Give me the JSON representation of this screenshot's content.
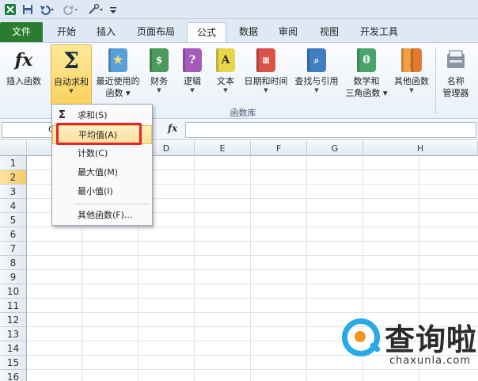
{
  "tabs": [
    {
      "label": "文件",
      "kind": "file"
    },
    {
      "label": "开始"
    },
    {
      "label": "插入"
    },
    {
      "label": "页面布局"
    },
    {
      "label": "公式",
      "active": true
    },
    {
      "label": "数据"
    },
    {
      "label": "审阅"
    },
    {
      "label": "视图"
    },
    {
      "label": "开发工具"
    }
  ],
  "ribbon": {
    "insert_function": "插入函数",
    "autosum": "自动求和",
    "recent_line1": "最近使用的",
    "recent_line2": "函数",
    "finance": "财务",
    "logic": "逻辑",
    "text": "文本",
    "datetime": "日期和时间",
    "lookup": "查找与引用",
    "math_line1": "数学和",
    "math_line2": "三角函数",
    "other": "其他函数",
    "name_mgr_line1": "名称",
    "name_mgr_line2": "管理器",
    "group_label": "函数库",
    "icon_fx": "fx",
    "icon_sigma": "Σ",
    "icon_q": "?",
    "icon_a": "A",
    "icon_theta": "θ"
  },
  "formula_bar": {
    "fx": "fx",
    "namebox_partial": "C"
  },
  "dropdown": {
    "items": [
      "求和(S)",
      "平均值(A)",
      "计数(C)",
      "最大值(M)",
      "最小值(I)",
      "其他函数(F)..."
    ],
    "highlighted_index": 1,
    "sigma": "Σ"
  },
  "grid": {
    "columns": [
      "B",
      "C",
      "D",
      "E",
      "F",
      "G",
      "H"
    ],
    "selected_column": "C",
    "rows": [
      "1",
      "2",
      "3",
      "4",
      "5",
      "6",
      "7",
      "8",
      "9",
      "10",
      "11",
      "12",
      "13",
      "14",
      "15",
      "16"
    ],
    "selected_row": "2"
  },
  "watermark": {
    "text": "查询啦",
    "sub": "chaxunla.com"
  },
  "colors": {
    "file_tab": "#2a7d2f",
    "highlight": "#fbd35e",
    "red_box": "#e0262a",
    "watermark_blue": "#2aa9e7",
    "watermark_orange": "#f29620"
  }
}
